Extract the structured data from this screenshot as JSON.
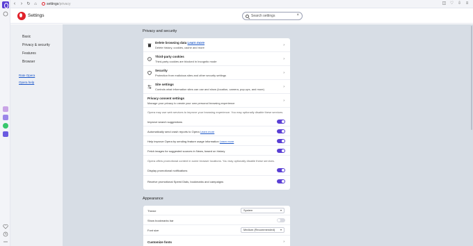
{
  "browser": {
    "url_host": "settings",
    "url_path": "/privacy",
    "icons": [
      "back-icon",
      "forward-icon",
      "reload-icon",
      "home-icon"
    ]
  },
  "header": {
    "title": "Settings",
    "search_placeholder": "Search settings"
  },
  "nav": {
    "items": [
      "Basic",
      "Privacy & security",
      "Features",
      "Browser"
    ],
    "links": [
      "Rate Opera",
      "Opera help"
    ]
  },
  "privacy": {
    "title": "Privacy and security",
    "rows": [
      {
        "title": "Delete browsing data",
        "link": "Learn more",
        "sub": "Delete history, cookies, cache and more"
      },
      {
        "title": "Third-party cookies",
        "sub": "Third-party cookies are blocked in Incognito mode"
      },
      {
        "title": "Security",
        "sub": "Protection from malicious sites and other security settings"
      },
      {
        "title": "Site settings",
        "sub": "Controls what information sites can use and show (location, camera, pop-ups, and more)"
      },
      {
        "title": "Privacy consent settings",
        "sub": "Manage your privacy to create your own personal browsing experience"
      }
    ],
    "web_services_note": "Opera may use web services to improve your browsing experience. You may optionally disable these services.",
    "toggles": [
      {
        "label": "Improve search suggestions",
        "on": true
      },
      {
        "label": "Automatically send crash reports to Opera",
        "link": "Learn more",
        "on": true
      },
      {
        "label": "Help improve Opera by sending feature usage information",
        "link": "Learn more",
        "on": true
      },
      {
        "label": "Fetch images for suggested sources in News, based on history",
        "on": true
      }
    ],
    "promo_note": "Opera offers promotional content in some browser locations. You may optionally disable these services.",
    "promo_toggles": [
      {
        "label": "Display promotional notifications",
        "on": true
      },
      {
        "label": "Receive promotional Speed Dials, bookmarks and campaigns",
        "on": true
      }
    ]
  },
  "appearance": {
    "title": "Appearance",
    "theme_label": "Theme",
    "theme_value": "System",
    "bookmarks_label": "Show bookmarks bar",
    "bookmarks_on": false,
    "font_label": "Font size",
    "font_value": "Medium (Recommended)",
    "customize_label": "Customize fonts"
  },
  "colors": {
    "accent": "#5a3fd4",
    "brand": "#e0222b",
    "link": "#1a56c8",
    "content_bg": "#d7dde5"
  }
}
